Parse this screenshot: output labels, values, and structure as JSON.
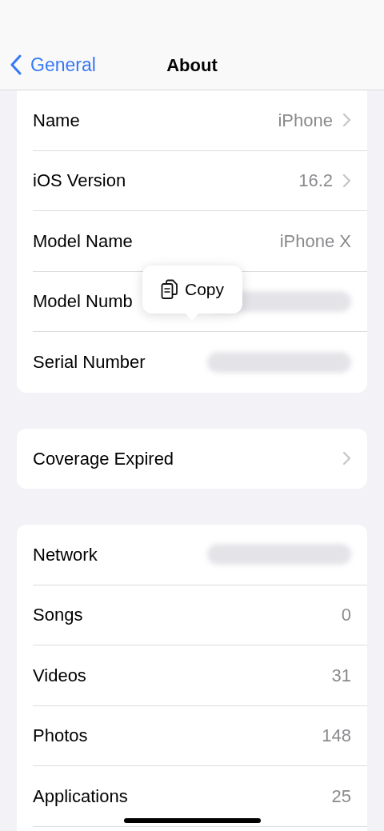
{
  "nav": {
    "back_label": "General",
    "title": "About"
  },
  "groups": [
    {
      "top_cut": true,
      "rows": [
        {
          "kind": "value",
          "label": "Name",
          "value": "iPhone",
          "chevron": true
        },
        {
          "kind": "value",
          "label": "iOS Version",
          "value": "16.2",
          "chevron": true
        },
        {
          "kind": "value",
          "label": "Model Name",
          "value": "iPhone X",
          "chevron": false
        },
        {
          "kind": "blurred",
          "label": "Model Numb",
          "chevron": false
        },
        {
          "kind": "blurred",
          "label": "Serial Number",
          "chevron": false
        }
      ]
    },
    {
      "top_cut": false,
      "rows": [
        {
          "kind": "value",
          "label": "Coverage Expired",
          "chevron": true
        }
      ]
    },
    {
      "top_cut": false,
      "rows": [
        {
          "kind": "blurred",
          "label": "Network",
          "chevron": false
        },
        {
          "kind": "value",
          "label": "Songs",
          "value": "0",
          "chevron": false
        },
        {
          "kind": "value",
          "label": "Videos",
          "value": "31",
          "chevron": false
        },
        {
          "kind": "value",
          "label": "Photos",
          "value": "148",
          "chevron": false
        },
        {
          "kind": "value",
          "label": "Applications",
          "value": "25",
          "chevron": false
        },
        {
          "kind": "empty"
        }
      ]
    }
  ],
  "popup": {
    "label": "Copy"
  }
}
